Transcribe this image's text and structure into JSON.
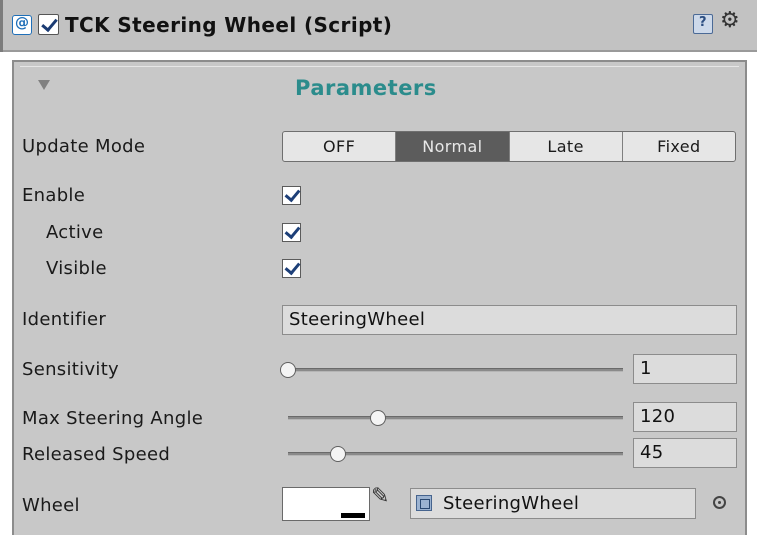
{
  "header": {
    "title": "TCK Steering Wheel (Script)",
    "enabled": true,
    "icons": [
      "script-icon",
      "help-icon",
      "gear-icon"
    ]
  },
  "section": {
    "title": "Parameters",
    "fold_icon": "triangle-down-icon"
  },
  "fields": {
    "update_mode": {
      "label": "Update Mode",
      "options": [
        "OFF",
        "Normal",
        "Late",
        "Fixed"
      ],
      "selected": "Normal"
    },
    "enable": {
      "label": "Enable",
      "checked": true
    },
    "active": {
      "label": "Active",
      "checked": true
    },
    "visible": {
      "label": "Visible",
      "checked": true
    },
    "identifier": {
      "label": "Identifier",
      "value": "SteeringWheel"
    },
    "sensitivity": {
      "label": "Sensitivity",
      "value": "1",
      "slider_fraction": 0.0
    },
    "max_steering_angle": {
      "label": "Max Steering Angle",
      "value": "120",
      "slider_fraction": 0.27
    },
    "released_speed": {
      "label": "Released Speed",
      "value": "45",
      "slider_fraction": 0.15
    },
    "wheel": {
      "label": "Wheel",
      "color": "#ffffff",
      "object_value": "SteeringWheel",
      "icons": [
        "eyedropper-icon",
        "object-icon",
        "object-picker-icon"
      ]
    }
  },
  "colors": {
    "accent": "#2b8c8c",
    "selected_segment": "#5c5c5c",
    "panel": "#c8c8c8",
    "header": "#c2c2c2"
  }
}
